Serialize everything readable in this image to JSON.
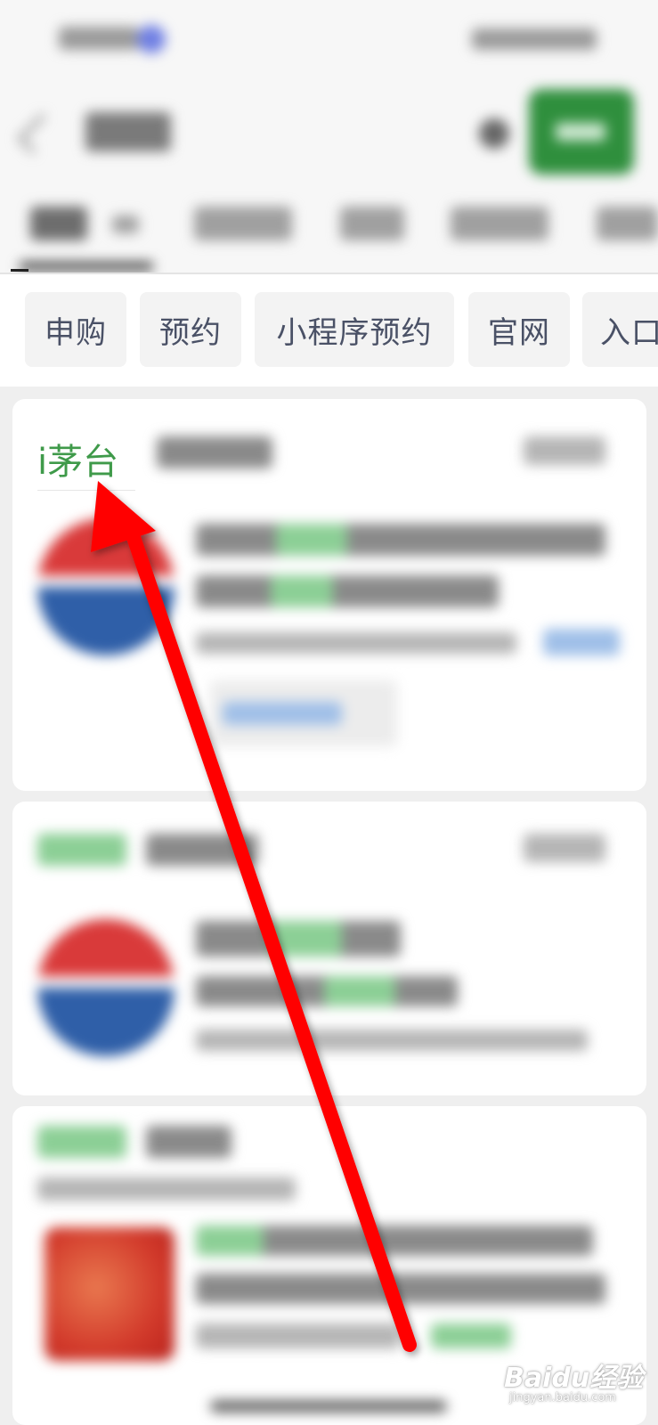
{
  "filter_chips": [
    "申购",
    "预约",
    "小程序预约",
    "官网",
    "入口"
  ],
  "first_result": {
    "account_name": "i茅台"
  },
  "watermark": {
    "brand": "Baidu经验",
    "url": "jingyan.baidu.com"
  },
  "annotation": {
    "color": "#ff0000",
    "type": "arrow pointing to account name"
  },
  "colors": {
    "accent_green": "#3f9a4a",
    "search_button": "#2f8f3d",
    "chip_text": "#4a5166"
  }
}
